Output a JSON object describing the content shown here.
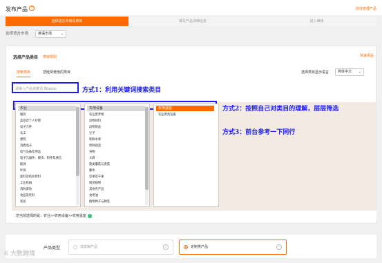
{
  "header": {
    "title": "发布产品",
    "help": "?",
    "top_link": "前往管理产品"
  },
  "steps": [
    "选择语言市场及类目",
    "填写产品详细信息",
    "进入审核"
  ],
  "market": {
    "label": "选择语言市场",
    "value": "英语市场"
  },
  "category_section": {
    "title": "选择产品类目",
    "link": "类目规则",
    "quick_link": "快速添品",
    "tabs": [
      "搜索类目",
      "您经常使用的类目"
    ],
    "lang_label": "选择类目显示语言",
    "lang_value": "简体中文",
    "search_placeholder": "请输入产品关键词 如laptop"
  },
  "annotations": {
    "method1": "方式1：利用关键词搜索类目",
    "method2": "方式2：按照自己对类目的理解，层层筛选",
    "method3": "方式3：前台参考一下同行"
  },
  "columns": {
    "col1": {
      "head": "农业",
      "items": [
        "服装",
        "美容及个人护理",
        "电子元件",
        "化工",
        "建筑",
        "消费电子",
        "电气设备及用品",
        "电子元器件、模块、附件及通信",
        "能源",
        "环保",
        "面料及纺织原料",
        "工业机械",
        "消防安防",
        "食品及饮料",
        "家居"
      ]
    },
    "col2": {
      "head": "农用设备",
      "items": [
        "农业废弃物",
        "动物饲料",
        "动物制品",
        "豆子",
        "新鲜水果",
        "新鲜蔬菜",
        "谷物",
        "大麻",
        "菌类蘑菇与香菇",
        "藤条",
        "坚果及干果",
        "观赏植物",
        "其他农产品",
        "食用油",
        "植物种子与鳞茎"
      ]
    },
    "col3": {
      "selected": "农用温室",
      "items": [
        "农业用具设备"
      ]
    }
  },
  "path": {
    "label": "您当前选择的是：",
    "value": "农业>>农用设备>>农用温室",
    "check": "✓"
  },
  "product_type": {
    "label": "产品类型",
    "options": [
      "非定制产品",
      "定制类产品"
    ],
    "selected_index": 1
  },
  "watermark": "K 大数跨境",
  "colors": {
    "accent": "#ff6a00",
    "annotation": "#1a1aff",
    "success": "#2bb673"
  }
}
